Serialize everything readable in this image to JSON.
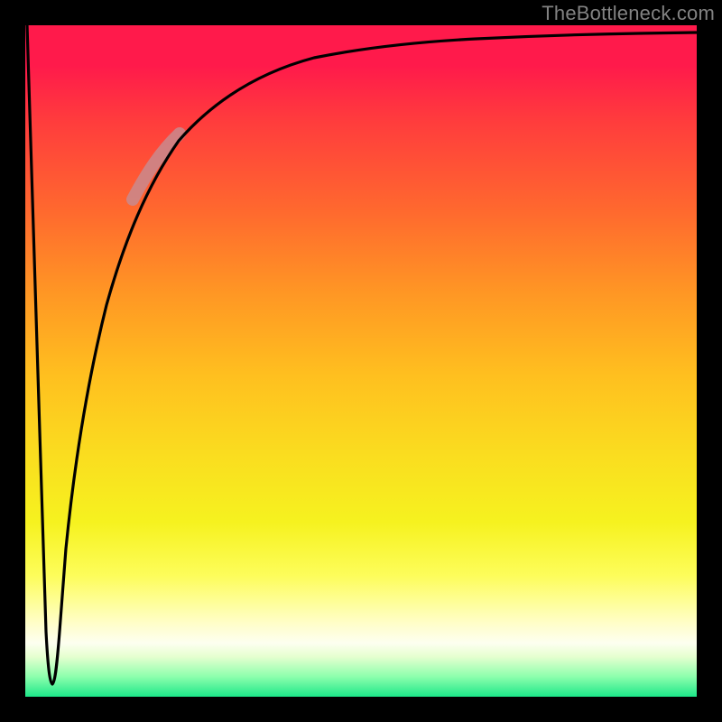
{
  "watermark": "TheBottleneck.com",
  "chart_data": {
    "type": "line",
    "title": "",
    "xlabel": "",
    "ylabel": "",
    "xlim": [
      0,
      100
    ],
    "ylim": [
      0,
      100
    ],
    "grid": false,
    "legend": false,
    "series": [
      {
        "name": "bottleneck-curve",
        "x": [
          0,
          2,
          3,
          3.5,
          4,
          5,
          6,
          8,
          10,
          12,
          15,
          18,
          22,
          26,
          30,
          35,
          40,
          45,
          50,
          55,
          60,
          65,
          70,
          75,
          80,
          85,
          90,
          95,
          100
        ],
        "y": [
          100,
          40,
          10,
          3,
          2,
          10,
          22,
          40,
          52,
          60,
          68,
          74,
          79,
          82.5,
          85,
          87.5,
          89.2,
          90.7,
          91.8,
          92.7,
          93.4,
          94,
          94.5,
          94.9,
          95.3,
          95.6,
          95.9,
          96.1,
          96.3
        ]
      }
    ],
    "highlight": {
      "x_start": 16,
      "x_end": 23,
      "note": "faded thick segment on curve"
    },
    "background_gradient": {
      "top": "#ff1a4b",
      "mid": "#fadd1f",
      "bottom": "#1de789"
    }
  }
}
